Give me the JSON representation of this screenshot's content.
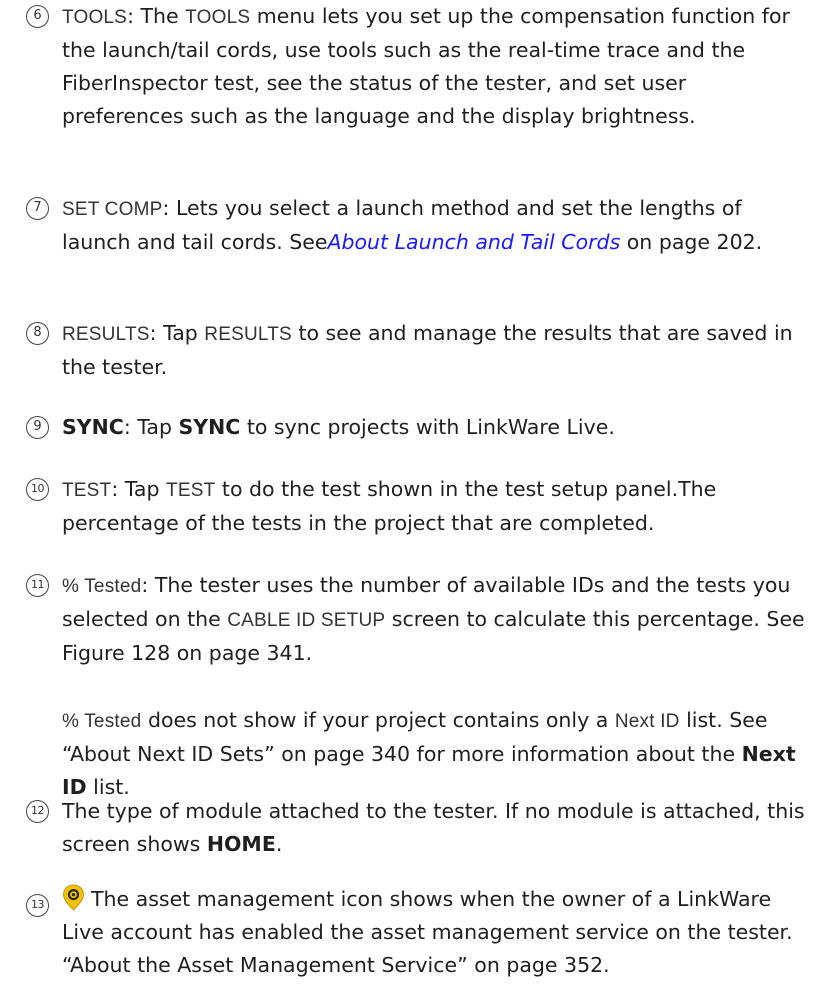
{
  "items": [
    {
      "number": "6",
      "ui_term": "TOOLS",
      "colon": ":",
      "text_1": " The ",
      "ui_term_2": "TOOLS",
      "text_2": " menu lets you set up the compensation function for the launch/tail cords, use tools such as the real-time trace and the FiberInspector test, see the status of the tester, and set user preferences such as the language and the display brightness."
    },
    {
      "number": "7",
      "ui_term": "SET COMP",
      "colon": ":",
      "text_1": " Lets you select a launch method and set the lengths of launch and tail cords. See",
      "link": "About Launch and Tail Cords",
      "text_2": " on page 202."
    },
    {
      "number": "8",
      "ui_term": "RESULTS",
      "colon": ":",
      "text_1": " Tap ",
      "ui_term_2": "RESULTS",
      "text_2": " to see and manage the results that are saved in the tester."
    },
    {
      "number": "9",
      "bold_term": "SYNC",
      "colon": ":",
      "text_1": " Tap ",
      "bold_term_2": "SYNC",
      "text_2": " to sync projects with LinkWare Live."
    },
    {
      "number": "10",
      "ui_term": "TEST",
      "colon": ":",
      "text_1": " Tap ",
      "ui_term_2": "TEST",
      "text_2": " to do the test shown in the test setup panel.The percentage of the tests in the project that are completed."
    },
    {
      "number": "11",
      "ui_term": "% Tested",
      "colon": ":",
      "text_1": " The tester uses the number of available IDs and the tests you selected on the ",
      "ui_term_2": "CABLE ID SETUP",
      "text_2": " screen to calculate this percentage. See Figure 128 on page 341.",
      "sub_ui_term": "% Tested",
      "sub_text_1": " does not show if your project contains only a ",
      "sub_ui_term_2": "Next ID",
      "sub_text_2": " list. See “About Next ID Sets” on page 340 for more information about the ",
      "sub_bold": "Next ID",
      "sub_text_3": " list."
    },
    {
      "number": "12",
      "text_1": "The type of module attached to the tester. If no module is attached, this screen shows ",
      "bold_term": "HOME",
      "text_2": "."
    },
    {
      "number": "13",
      "icon": "asset-management-icon",
      "text_1": "The asset management icon shows when the owner of a LinkWare Live account has enabled the asset management service on the tester. “About the Asset Management Service” on page 352."
    }
  ],
  "colors": {
    "text": "#1f1f1f",
    "link": "#1a1aff",
    "icon_outer": "#f2c200",
    "icon_inner": "#2a2a2a"
  }
}
